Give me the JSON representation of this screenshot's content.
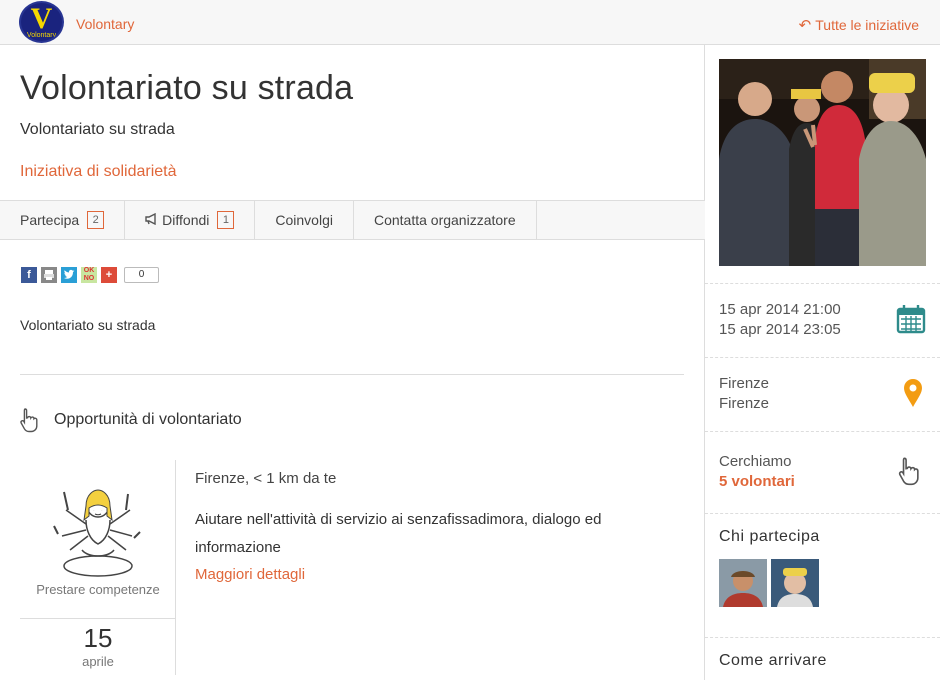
{
  "header": {
    "logo_letter": "V",
    "logo_text": "Volontary",
    "brand": "Volontary",
    "back_link": "Tutte le iniziative"
  },
  "event": {
    "title": "Volontariato su strada",
    "subtitle": "Volontariato su strada",
    "category": "Iniziativa di solidarietà",
    "description": "Volontariato su strada"
  },
  "tabs": [
    {
      "label": "Partecipa",
      "count": "2"
    },
    {
      "label": "Diffondi",
      "count": "1"
    },
    {
      "label": "Coinvolgi"
    },
    {
      "label": "Contatta organizzatore"
    }
  ],
  "share": {
    "buttons": [
      "facebook-icon",
      "print-icon",
      "twitter-icon",
      "oknotizie-icon",
      "addthis-icon"
    ],
    "count": "0",
    "ok_label": "OK NO"
  },
  "opportunities": {
    "heading": "Opportunità di volontariato",
    "items": [
      {
        "image_label": "Prestare competenze",
        "day": "15",
        "month": "aprile",
        "location": "Firenze, < 1 km da te",
        "text": "Aiutare nell'attività di servizio ai senzafissadimora, dialogo ed informazione",
        "more": "Maggiori dettagli"
      }
    ]
  },
  "sidebar": {
    "date_start": "15 apr 2014 21:00",
    "date_end": "15 apr 2014 23:05",
    "city": "Firenze",
    "place": "Firenze",
    "seeking_label": "Cerchiamo",
    "seeking_value": "5 volontari",
    "participants_heading": "Chi partecipa",
    "directions_heading": "Come arrivare"
  },
  "colors": {
    "accent": "#e0673a",
    "calendar": "#2e8b8b",
    "pin": "#f39c12"
  }
}
